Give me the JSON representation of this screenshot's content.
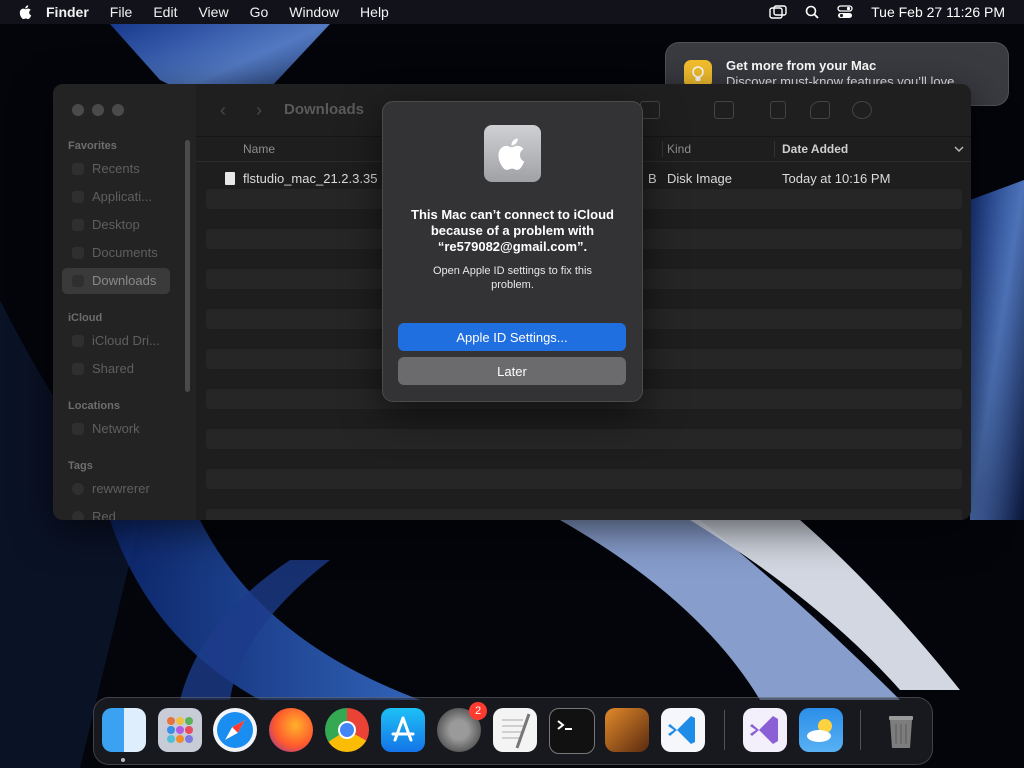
{
  "menubar": {
    "app_name": "Finder",
    "menus": [
      "File",
      "Edit",
      "View",
      "Go",
      "Window",
      "Help"
    ],
    "clock": "Tue Feb 27  11:26 PM",
    "status_icons": [
      "screen-mirroring-icon",
      "search-icon",
      "control-center-icon"
    ]
  },
  "notification": {
    "title": "Get more from your Mac",
    "body": "Discover must-know features you’ll love.",
    "icon": "lightbulb-icon",
    "icon_color": "#f6c12e"
  },
  "finder": {
    "title": "Downloads",
    "sidebar": {
      "favorites_header": "Favorites",
      "favorites": [
        "Recents",
        "Applicati...",
        "Desktop",
        "Documents",
        "Downloads"
      ],
      "selected": "Downloads",
      "icloud_header": "iCloud",
      "icloud": [
        "iCloud Dri...",
        "Shared"
      ],
      "locations_header": "Locations",
      "locations": [
        "Network"
      ],
      "tags_header": "Tags",
      "tags": [
        "rewwrerer",
        "Red"
      ]
    },
    "columns": {
      "name": "Name",
      "kind": "Kind",
      "date_added": "Date Added"
    },
    "file": {
      "name": "flstudio_mac_21.2.3.35",
      "size_fragment": "B",
      "kind": "Disk Image",
      "date_added": "Today at 10:16 PM"
    }
  },
  "dialog": {
    "icon": "apple-logo-icon",
    "title": "This Mac can’t connect to iCloud because of a problem with “re579082@gmail.com”.",
    "message": "Open Apple ID settings to fix this problem.",
    "primary_button": "Apple ID Settings...",
    "secondary_button": "Later",
    "primary_color": "#1f6fe0"
  },
  "dock": {
    "apps": [
      "finder-icon",
      "launchpad-icon",
      "safari-icon",
      "firefox-icon",
      "chrome-icon",
      "app-store-icon",
      "system-settings-icon",
      "textedit-icon",
      "terminal-icon",
      "garageband-icon",
      "vscode-icon",
      "visual-studio-icon",
      "weather-icon",
      "trash-icon"
    ],
    "badge_count": "2"
  }
}
